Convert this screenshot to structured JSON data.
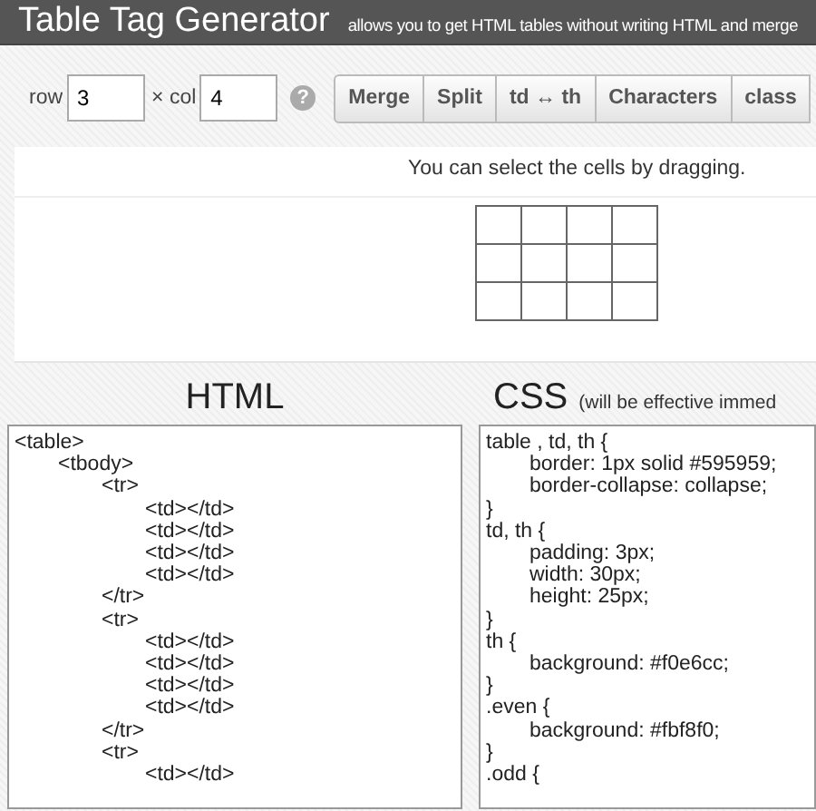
{
  "header": {
    "title": "Table Tag Generator",
    "subtitle": "allows you to get HTML tables without writing HTML and merge"
  },
  "toolbar": {
    "row_label": "row",
    "row_value": "3",
    "col_label": "× col",
    "col_value": "4",
    "help": "?",
    "buttons": [
      "Merge",
      "Split",
      "td ↔ th",
      "Characters",
      "class"
    ]
  },
  "preview": {
    "hint": "You can select the cells by dragging."
  },
  "html_panel": {
    "heading": "HTML",
    "lines": [
      {
        "text": "<table>",
        "children": [
          {
            "text": "<tbody>",
            "children": [
              {
                "text": "<tr>",
                "children": [
                  {
                    "text": "<td></td>"
                  },
                  {
                    "text": "<td></td>"
                  },
                  {
                    "text": "<td></td>"
                  },
                  {
                    "text": "<td></td>"
                  }
                ]
              },
              {
                "text": "</tr>"
              },
              {
                "text": "<tr>",
                "children": [
                  {
                    "text": "<td></td>"
                  },
                  {
                    "text": "<td></td>"
                  },
                  {
                    "text": "<td></td>"
                  },
                  {
                    "text": "<td></td>"
                  }
                ]
              },
              {
                "text": "</tr>"
              },
              {
                "text": "<tr>",
                "children": [
                  {
                    "text": "<td></td>"
                  }
                ]
              }
            ]
          }
        ]
      }
    ]
  },
  "css_panel": {
    "heading": "CSS",
    "note": "(will be effective immed",
    "lines": [
      {
        "text": "table , td, th {",
        "children": [
          {
            "text": "border: 1px solid #595959;"
          },
          {
            "text": "border-collapse: collapse;"
          }
        ]
      },
      {
        "text": "}"
      },
      {
        "text": "td, th {",
        "children": [
          {
            "text": "padding: 3px;"
          },
          {
            "text": "width: 30px;"
          },
          {
            "text": "height: 25px;"
          }
        ]
      },
      {
        "text": "}"
      },
      {
        "text": "th {",
        "children": [
          {
            "text": "background: #f0e6cc;"
          }
        ]
      },
      {
        "text": "}"
      },
      {
        "text": ".even {",
        "children": [
          {
            "text": "background: #fbf8f0;"
          }
        ]
      },
      {
        "text": "}"
      },
      {
        "text": ".odd {"
      }
    ]
  }
}
